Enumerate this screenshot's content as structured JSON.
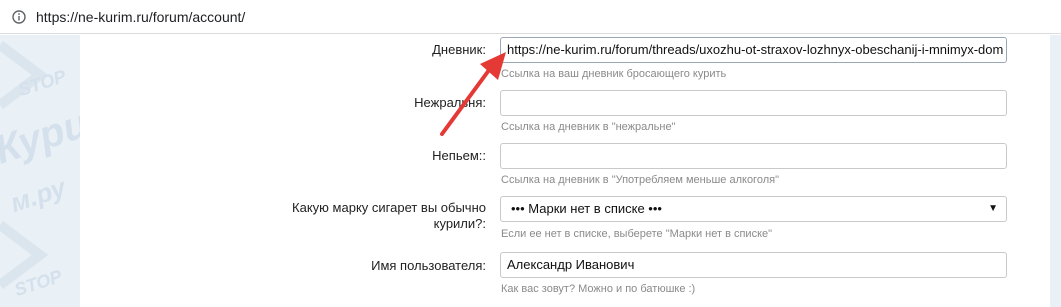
{
  "browser": {
    "url": "https://ne-kurim.ru/forum/account/"
  },
  "watermark": {
    "top": "STOP",
    "middle": "Кури",
    "bottom": "м.ру",
    "bottom2": "STOP"
  },
  "form": {
    "rows": [
      {
        "label": "Дневник:",
        "value": "https://ne-kurim.ru/forum/threads/uxozhu-ot-straxov-lozhnyx-obeschanij-i-mnimyx-dom",
        "hint": "Ссылка на ваш дневник бросающего курить"
      },
      {
        "label": "Нежральня:",
        "value": "",
        "hint": "Ссылка на дневник в \"нежральне\""
      },
      {
        "label": "Непьем::",
        "value": "",
        "hint": "Ссылка на дневник в \"Употребляем меньше алкоголя\""
      },
      {
        "label": "Какую марку сигарет вы обычно курили?:",
        "label_line1": "Какую марку сигарет вы обычно",
        "label_line2": "курили?:",
        "value": "••• Марки нет в списке •••",
        "caret": "▼",
        "hint": "Если ее нет в списке, выберете \"Марки нет в списке\""
      },
      {
        "label": "Имя пользователя:",
        "value": "Александр Иванович",
        "hint": "Как вас зовут? Можно и по батюшке :)"
      }
    ]
  },
  "colors": {
    "annotation_arrow": "#e53935",
    "sidebar_bg": "#e9f0f6",
    "hint_text": "#8a8a8a"
  }
}
